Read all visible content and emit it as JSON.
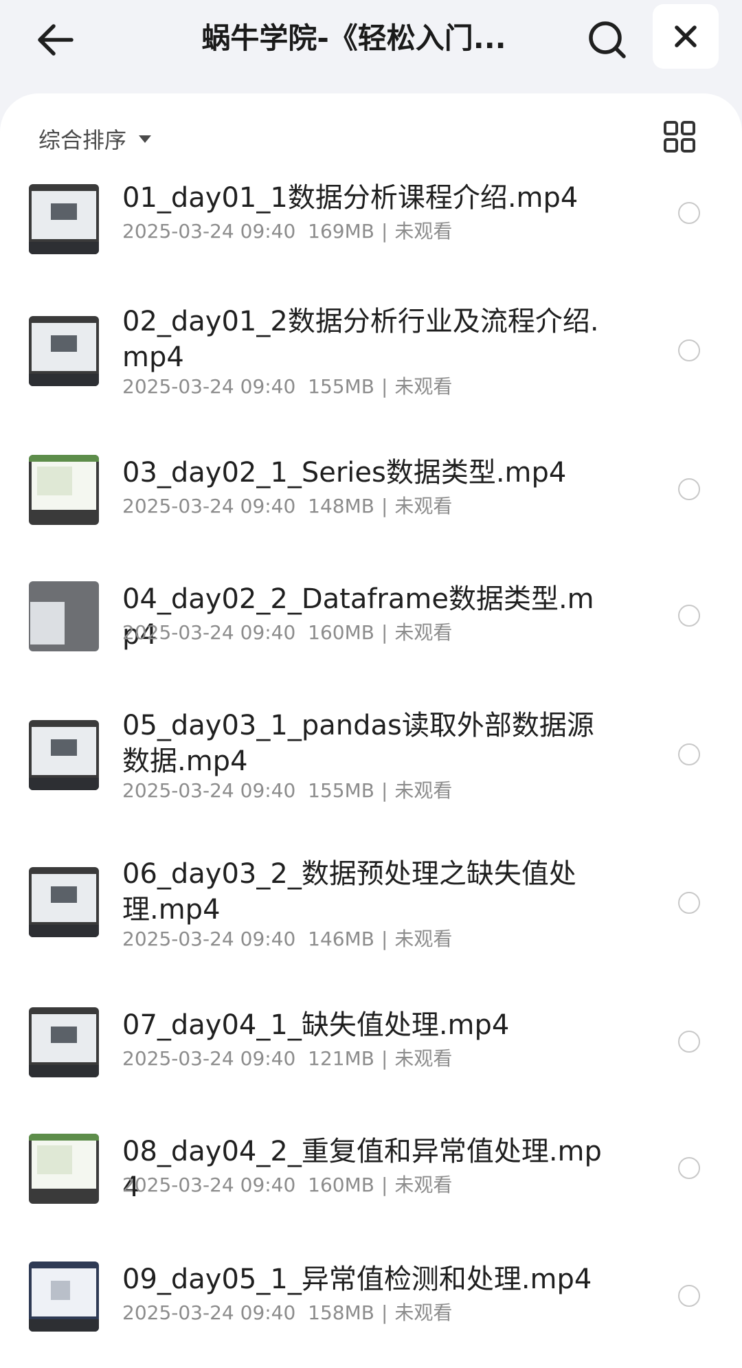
{
  "header": {
    "title": "蜗牛学院-《轻松入门...",
    "icons": {
      "back": "arrow-left-icon",
      "search": "search-icon",
      "close": "close-icon"
    }
  },
  "sort": {
    "label": "综合排序",
    "icon": "caret-down-icon"
  },
  "view_toggle_icon": "grid-view-icon",
  "files": [
    {
      "name": "01_day01_1数据分析课程介绍.mp4",
      "date": "2025-03-24 09:40",
      "size": "169MB",
      "status": "未观看"
    },
    {
      "name": "02_day01_2数据分析行业及流程介绍.mp4",
      "date": "2025-03-24 09:40",
      "size": "155MB",
      "status": "未观看"
    },
    {
      "name": "03_day02_1_Series数据类型.mp4",
      "date": "2025-03-24 09:40",
      "size": "148MB",
      "status": "未观看"
    },
    {
      "name": "04_day02_2_Dataframe数据类型.mp4",
      "date": "2025-03-24 09:40",
      "size": "160MB",
      "status": "未观看"
    },
    {
      "name": "05_day03_1_pandas读取外部数据源数据.mp4",
      "date": "2025-03-24 09:40",
      "size": "155MB",
      "status": "未观看"
    },
    {
      "name": "06_day03_2_数据预处理之缺失值处理.mp4",
      "date": "2025-03-24 09:40",
      "size": "146MB",
      "status": "未观看"
    },
    {
      "name": "07_day04_1_缺失值处理.mp4",
      "date": "2025-03-24 09:40",
      "size": "121MB",
      "status": "未观看"
    },
    {
      "name": "08_day04_2_重复值和异常值处理.mp4",
      "date": "2025-03-24 09:40",
      "size": "160MB",
      "status": "未观看"
    },
    {
      "name": "09_day05_1_异常值检测和处理.mp4",
      "date": "2025-03-24 09:40",
      "size": "158MB",
      "status": "未观看"
    }
  ],
  "colors": {
    "background": "#f2f3f7",
    "panel": "#ffffff",
    "meta_text": "#8c8c8c"
  }
}
